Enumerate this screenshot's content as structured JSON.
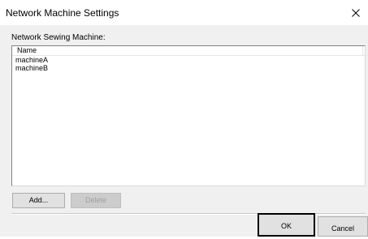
{
  "window": {
    "title": "Network Machine Settings"
  },
  "section": {
    "label": "Network Sewing Machine:"
  },
  "machine_list": {
    "columns": [
      "Name"
    ],
    "rows": [
      "machineA",
      "machineB"
    ]
  },
  "buttons": {
    "add": "Add...",
    "delete": "Delete",
    "ok": "OK",
    "cancel": "Cancel"
  },
  "icons": {
    "close": "close-icon"
  }
}
